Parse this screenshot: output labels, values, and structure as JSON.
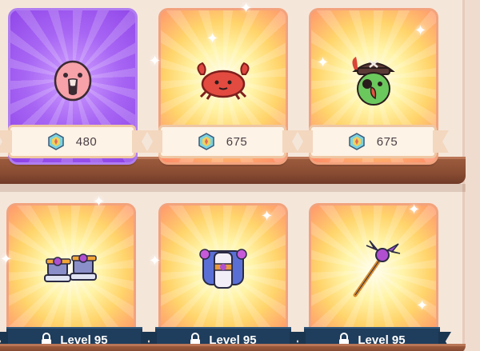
{
  "shop": {
    "shelf_color": "#8a4d33",
    "top_row": [
      {
        "item_icon": "flamingo-pet-icon",
        "price": "480",
        "currency_icon": "gem-currency-icon",
        "card_theme": "purple"
      },
      {
        "item_icon": "crab-pet-icon",
        "price": "675",
        "currency_icon": "gem-currency-icon",
        "card_theme": "gold"
      },
      {
        "item_icon": "pirate-parrot-pet-icon",
        "price": "675",
        "currency_icon": "gem-currency-icon",
        "card_theme": "gold"
      }
    ],
    "bottom_row": [
      {
        "item_icon": "armored-boots-icon",
        "lock_label": "Level 95",
        "lock_icon": "padlock-icon"
      },
      {
        "item_icon": "armored-outfit-icon",
        "lock_label": "Level 95",
        "lock_icon": "padlock-icon"
      },
      {
        "item_icon": "bat-wing-wand-icon",
        "lock_label": "Level 95",
        "lock_icon": "padlock-icon"
      }
    ]
  }
}
